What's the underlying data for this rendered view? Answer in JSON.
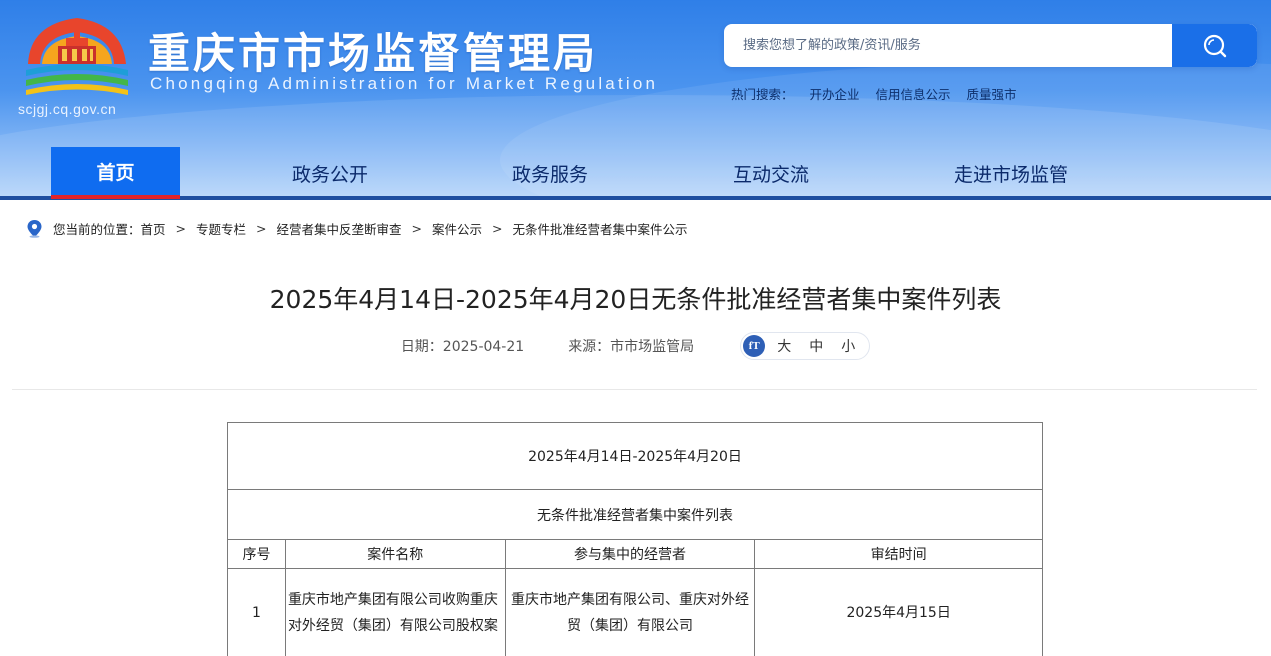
{
  "header": {
    "site_title": "重庆市市场监督管理局",
    "site_subtitle": "Chongqing Administration for Market Regulation",
    "domain": "scjgj.cq.gov.cn",
    "search": {
      "placeholder": "搜索您想了解的政策/资讯/服务"
    },
    "hot_label": "热门搜索：",
    "hot_items": [
      "开办企业",
      "信用信息公示",
      "质量强市"
    ]
  },
  "nav": {
    "items": [
      {
        "label": "首页",
        "active": true
      },
      {
        "label": "政务公开"
      },
      {
        "label": "政务服务"
      },
      {
        "label": "互动交流"
      },
      {
        "label": "走进市场监管"
      }
    ]
  },
  "breadcrumb": {
    "prefix": "您当前的位置：",
    "items": [
      "首页",
      "专题专栏",
      "经营者集中反垄断审查",
      "案件公示",
      "无条件批准经营者集中案件公示"
    ],
    "separator": ">"
  },
  "article": {
    "title": "2025年4月14日-2025年4月20日无条件批准经营者集中案件列表",
    "date_label": "日期：2025-04-21",
    "source_label": "来源：市市场监管局",
    "font_icon": "fT",
    "font_sizes": [
      "大",
      "中",
      "小"
    ]
  },
  "table": {
    "date_range": "2025年4月14日-2025年4月20日",
    "caption": "无条件批准经营者集中案件列表",
    "headers": [
      "序号",
      "案件名称",
      "参与集中的经营者",
      "审结时间"
    ],
    "rows": [
      {
        "no": "1",
        "case_name": "重庆市地产集团有限公司收购重庆对外经贸（集团）有限公司股权案",
        "parties": "重庆市地产集团有限公司、重庆对外经贸（集团）有限公司",
        "concluded": "2025年4月15日"
      }
    ]
  },
  "colors": {
    "header_blue": "#2f7fe8",
    "nav_active": "#0f6cf0",
    "nav_active_underline": "#e0242b",
    "nav_text": "#0b2a6b",
    "search_button": "#1a6fe8"
  },
  "icons": {
    "logo": "chongqing-amr-logo",
    "search": "search-icon",
    "location": "location-pin-icon"
  }
}
